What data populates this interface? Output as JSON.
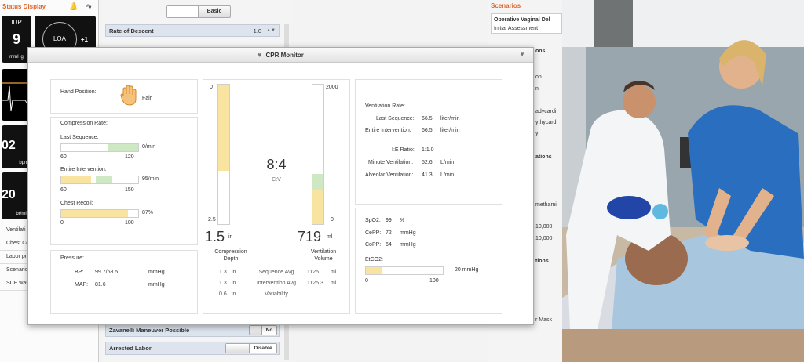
{
  "status_panel": {
    "title": "Status Display",
    "iup": {
      "label": "IUP",
      "value": "9",
      "unit": "mmHg"
    },
    "loa": {
      "label": "LOA",
      "plus": "+1"
    },
    "tile_02": {
      "value": "02",
      "unit": "bpm"
    },
    "tile_20": {
      "value": "20",
      "unit": "br/min"
    },
    "items": [
      "Ventilati",
      "Chest Co",
      "Labor pr resumed",
      "Scenario Delivery",
      "SCE was"
    ]
  },
  "center_panel": {
    "basic_label": "Basic",
    "rate_of_descent": {
      "label": "Rate of Descent",
      "value": "1.0"
    },
    "zavanelli": {
      "label": "Zavanelli Maneuver Possible",
      "value": "No"
    },
    "arrested": {
      "label": "Arrested Labor",
      "value": "Disable"
    }
  },
  "scenarios_panel": {
    "title": "Scenarios",
    "scenario_name": "Operative Vaginal Del",
    "scenario_sub": "Initial Assessment",
    "fragments": [
      "ons",
      "on",
      "n",
      "adycardi",
      "ythycardi",
      "y",
      "ations",
      "methami",
      "10,000",
      "10,000",
      "tions",
      "r Mask"
    ]
  },
  "cpr": {
    "title": "CPR Monitor",
    "hand": {
      "label": "Hand Position:",
      "value": "Fair"
    },
    "compression_rate": {
      "title": "Compression Rate:",
      "last": {
        "label": "Last Sequence:",
        "value": "0/min",
        "min": "60",
        "max": "120",
        "fill": 0.0,
        "target_lo": 0.6,
        "target_hi": 1.0
      },
      "entire": {
        "label": "Entire Intervention:",
        "value": "95/min",
        "min": "60",
        "max": "150",
        "fill": 0.39,
        "target_lo": 0.45,
        "target_hi": 0.66
      },
      "recoil": {
        "label": "Chest Recoil:",
        "value": "87%",
        "min": "0",
        "max": "100",
        "fill": 0.87
      }
    },
    "pressure": {
      "title": "Pressure:",
      "bp_label": "BP:",
      "bp_value": "99.7/68.5",
      "bp_unit": "mmHg",
      "map_label": "MAP:",
      "map_value": "81.6",
      "map_unit": "mmHg"
    },
    "gauges": {
      "depth_top": "0",
      "depth_bottom": "2.5",
      "depth_fill": 0.62,
      "volume_top": "2000",
      "volume_bottom": "0",
      "volume_fill": 0.36,
      "volume_zone": 0.12,
      "ratio": "8:4",
      "ratio_label": "C:V",
      "depth_value": "1.5",
      "depth_unit": "in",
      "depth_label_1": "Compression",
      "depth_label_2": "Depth",
      "volume_value": "719",
      "volume_unit": "ml",
      "volume_label_1": "Ventilation",
      "volume_label_2": "Volume",
      "rows": [
        {
          "left": "1.3",
          "left_unit": "in",
          "label": "Sequence Avg",
          "right": "1125",
          "right_unit": "ml"
        },
        {
          "left": "1.3",
          "left_unit": "in",
          "label": "Intervention Avg",
          "right": "1125.3",
          "right_unit": "ml"
        },
        {
          "left": "0.6",
          "left_unit": "in",
          "label": "Variability",
          "right": "",
          "right_unit": ""
        }
      ]
    },
    "ventilation": {
      "title": "Ventilation Rate:",
      "last_label": "Last Sequence:",
      "last_value": "66.5",
      "last_unit": "liter/min",
      "entire_label": "Entire Intervention:",
      "entire_value": "66.5",
      "entire_unit": "liter/min",
      "ie_label": "I:E Ratio:",
      "ie_value": "1:1.0",
      "minute_label": "Minute Ventilation:",
      "minute_value": "52.6",
      "minute_unit": "L/min",
      "alveolar_label": "Alveolar Ventilation:",
      "alveolar_value": "41.3",
      "alveolar_unit": "L/min"
    },
    "oxygen": {
      "spo2_label": "SpO2:",
      "spo2_value": "99",
      "spo2_unit": "%",
      "cepp_label": "CePP:",
      "cepp_value": "72",
      "cepp_unit": "mmHg",
      "copp_label": "CoPP:",
      "copp_value": "64",
      "copp_unit": "mmHg",
      "etco2_label": "EtCO2:",
      "etco2_value": "20 mmHg",
      "etco2_min": "0",
      "etco2_max": "100",
      "etco2_fill": 0.2
    }
  }
}
